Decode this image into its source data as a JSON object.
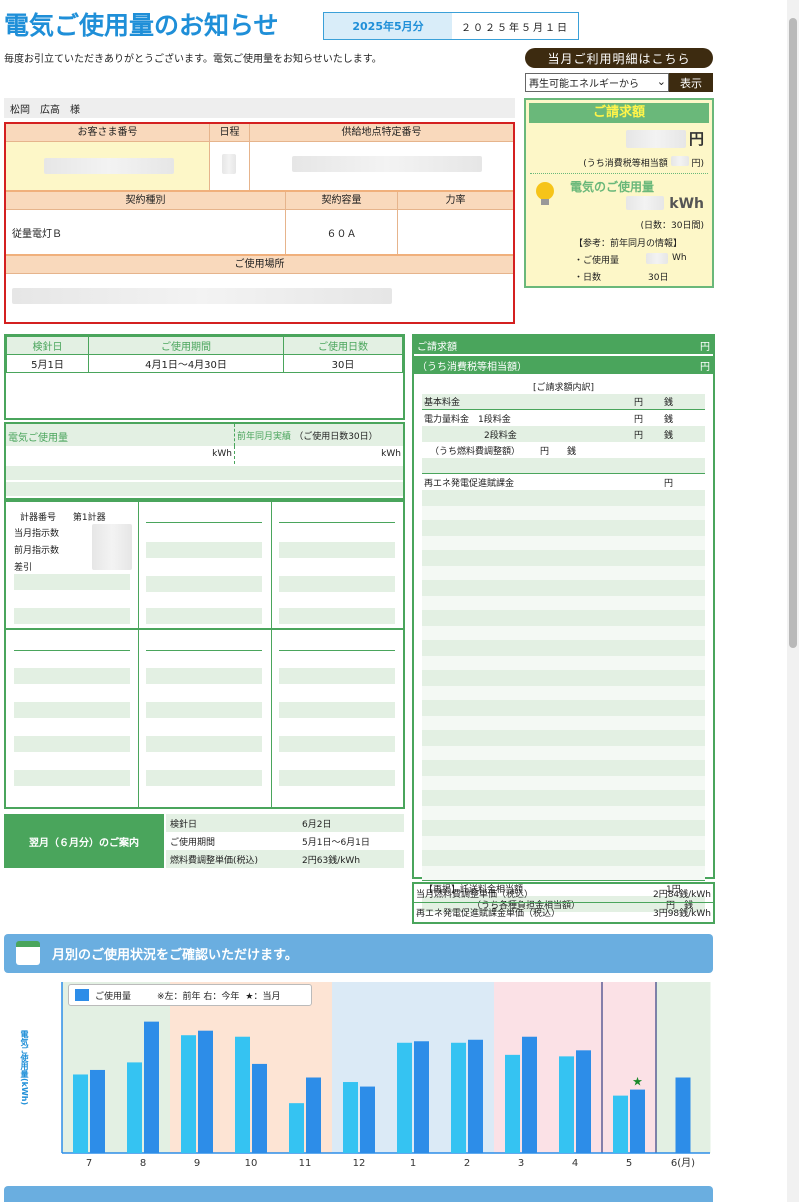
{
  "header": {
    "title": "電気ご使用量のお知らせ",
    "billing_month": "2025年5月分",
    "issue_date": "２０２５年５月１日",
    "greeting": "毎度お引立ていただきありがとうございます。電気ご使用量をお知らせいたします。",
    "detail_button": "当月ご利用明細はこちら",
    "select_value": "再生可能エネルギーから",
    "show_button": "表示"
  },
  "customer": {
    "name": "松岡　広高　様",
    "col_customer_number": "お客さま番号",
    "col_schedule": "日程",
    "col_supply_point": "供給地点特定番号",
    "col_contract_type": "契約種別",
    "col_contract_capacity": "契約容量",
    "col_power_factor": "力率",
    "contract_type": "従量電灯Ｂ",
    "contract_capacity": "６０Ａ",
    "col_usage_location": "ご使用場所"
  },
  "summary_card": {
    "bill_title": "ご請求額",
    "yen": "円",
    "tax_note": "(うち消費税等相当額",
    "tax_note_end": "円)",
    "usage_title": "電気のご使用量",
    "kwh": "kWh",
    "days_note": "(日数：30日間)",
    "ref_title": "【参考：前年同月の情報】",
    "ref_usage_label": "・ご使用量",
    "ref_usage_unit": "Wh",
    "ref_days_label": "・日数",
    "ref_days_value": "30日"
  },
  "meter": {
    "col_read_date": "検針日",
    "col_period": "ご使用期間",
    "col_days": "ご使用日数",
    "read_date": "5月1日",
    "period": "4月1日～4月30日",
    "days": "30日",
    "usage_label": "電気ご使用量",
    "prev_label": "前年同月実績",
    "prev_days": "（ご使用日数30日）",
    "kwh1": "kWh",
    "kwh2": "kWh",
    "meter_no_label": "計器番号",
    "meter_no": "第1計器",
    "cur_reading": "当月指示数",
    "prev_reading": "前月指示数",
    "diff": "差引"
  },
  "next_month": {
    "title": "翌月（６月分）のご案内",
    "read_date_label": "検針日",
    "read_date": "6月2日",
    "period_label": "ご使用期間",
    "period": "5月1日～6月1日",
    "fuel_label": "燃料費調整単価(税込)",
    "fuel_value": "2円63銭/kWh"
  },
  "bill_panel": {
    "bill_label": "ご請求額",
    "yen1": "円",
    "tax_label": "（うち消費税等相当額）",
    "yen2": "円",
    "breakdown": "[ご請求額内訳]",
    "base_fee": "基本料金",
    "energy_fee": "電力量料金　1段料金",
    "tier2": "2段料金",
    "fuel_adj": "（うち燃料費調整額）",
    "fuel_unit": "円　　銭",
    "renewable": "再エネ発電促進賦課金",
    "yen_unit": "円",
    "sen_unit": "銭",
    "trans_label": "【再掲】託送料金相当額",
    "trans_unit": "1円",
    "levy_label": "（うち各種負担金相当額）",
    "levy_unit": "円　銭"
  },
  "unit_prices": {
    "fuel_label": "当月燃料費調整単価（税込）",
    "fuel_value": "2円84銭/kWh",
    "renew_label": "再エネ発電促進賦課金単価（税込）",
    "renew_value": "3円98銭/kWh"
  },
  "chart_banner": "月別のご使用状況をご確認いただけます。",
  "chart_data": {
    "type": "bar",
    "ylabel": "電気ご使用量(kWh)",
    "legend_label": "ご使用量",
    "legend_note": "※左：前年 右：今年",
    "legend_star": "★：当月",
    "categories": [
      "7",
      "8",
      "9",
      "10",
      "11",
      "12",
      "1",
      "2",
      "3",
      "4",
      "5",
      "6(月)"
    ],
    "series": [
      {
        "values": [
          52,
          60,
          78,
          77,
          33,
          47,
          73,
          73,
          65,
          64,
          38,
          0
        ]
      },
      {
        "values": [
          55,
          87,
          81,
          59,
          50,
          44,
          74,
          75,
          77,
          68,
          42,
          50
        ]
      }
    ],
    "current_index": 10,
    "colors": {
      "prev": "#35c3f2",
      "cur": "#2d8de8"
    }
  }
}
